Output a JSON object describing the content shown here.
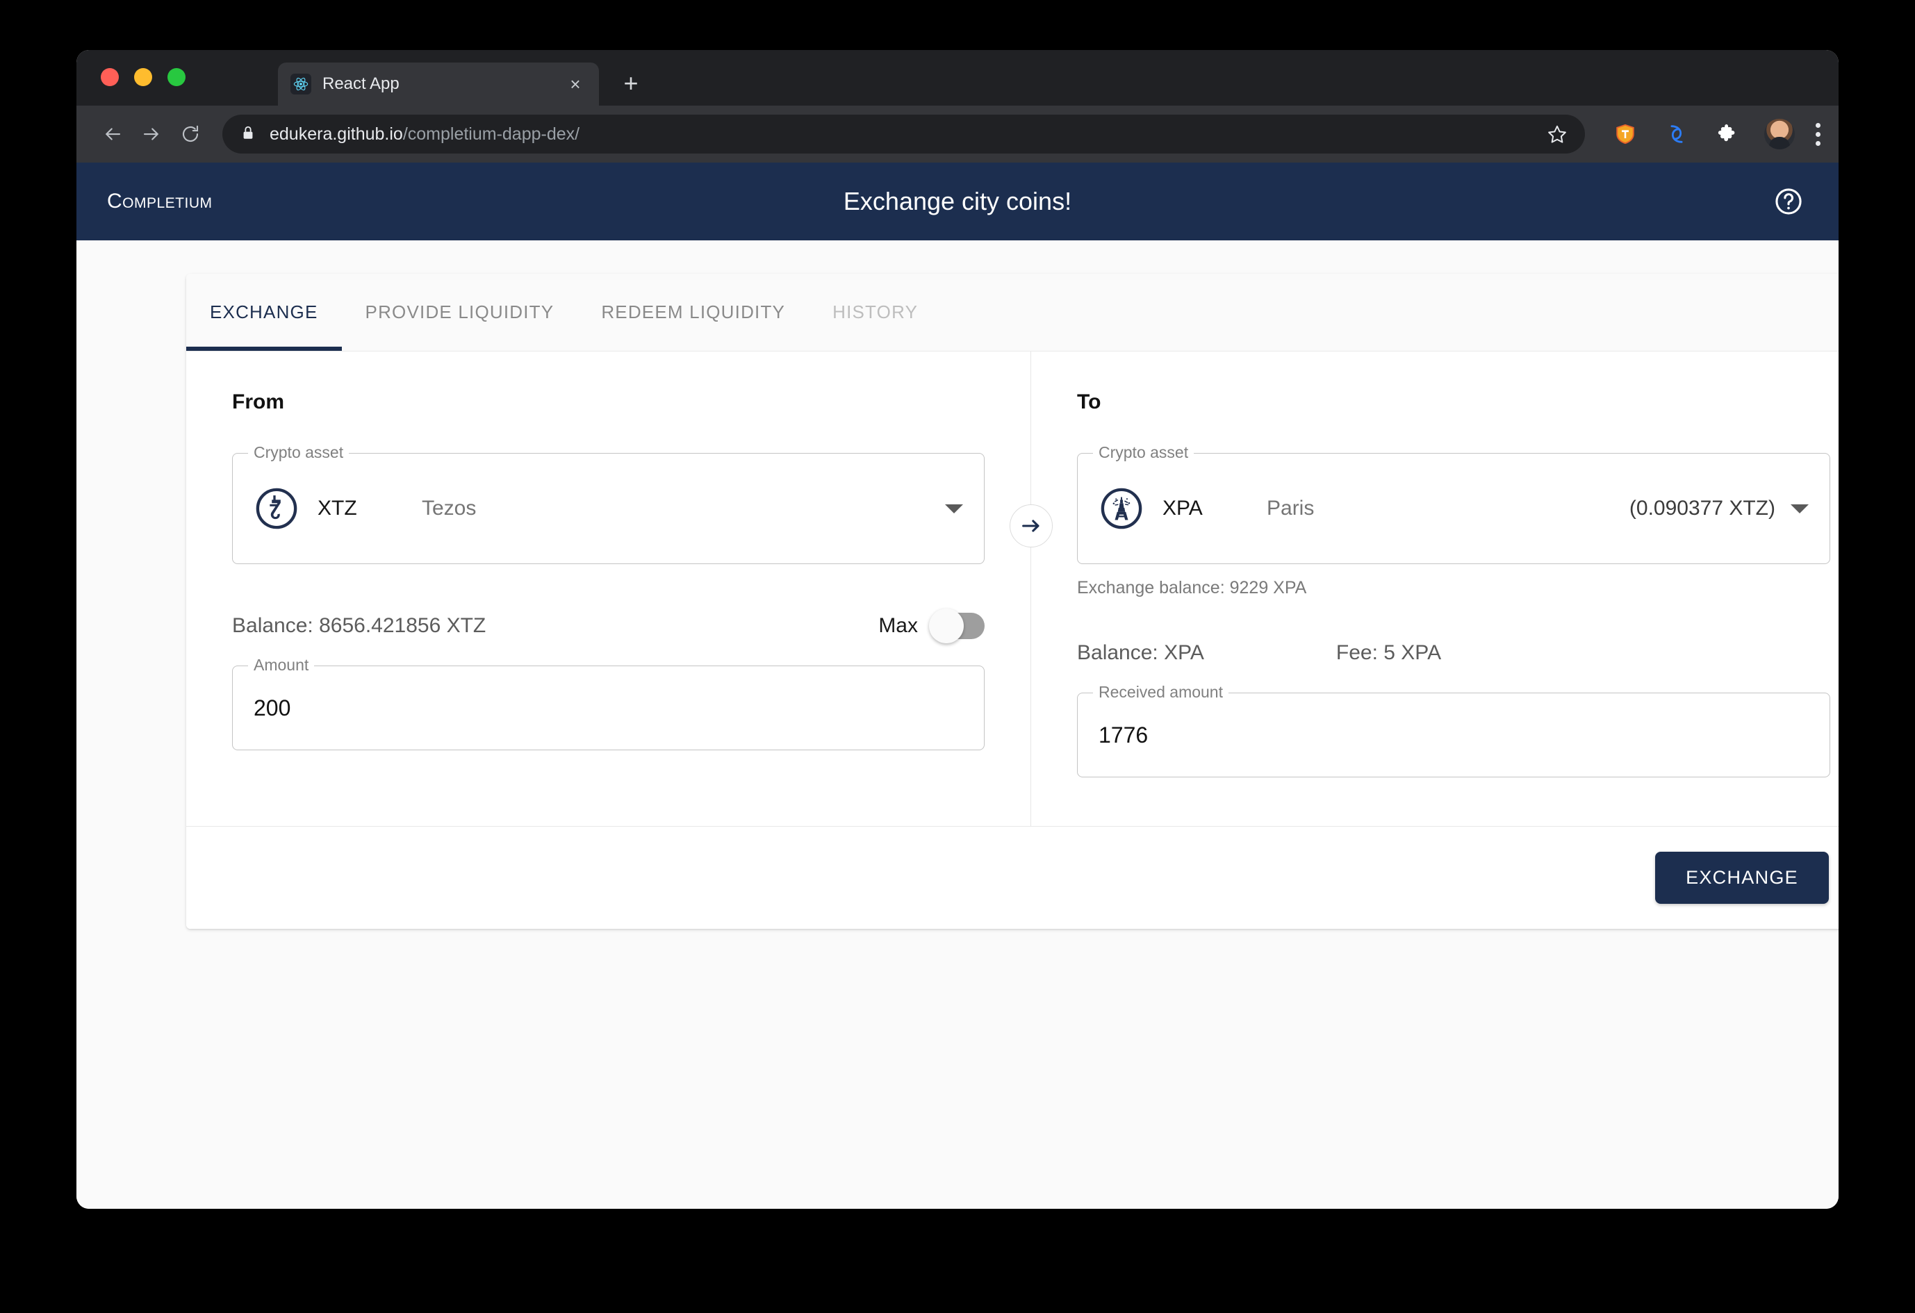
{
  "browser": {
    "tab": {
      "title": "React App",
      "favicon": "react-icon",
      "close_label": "×"
    },
    "new_tab_label": "+",
    "url_host": "edukera.github.io",
    "url_path": "/completium-dapp-dex/",
    "lock_icon": "lock-icon",
    "back_icon": "back-arrow-icon",
    "forward_icon": "forward-arrow-icon",
    "reload_icon": "reload-icon",
    "star_icon": "star-icon",
    "extensions": [
      "temple-wallet-icon",
      "beacon-icon",
      "puzzle-extensions-icon"
    ],
    "profile_icon": "avatar-icon",
    "menu_icon": "kebab-menu-icon"
  },
  "app": {
    "brand": "Completium",
    "title": "Exchange city coins!",
    "help_icon": "help-circle-icon",
    "accent_color": "#1c2e4f"
  },
  "tabs": [
    {
      "label": "EXCHANGE",
      "state": "active"
    },
    {
      "label": "PROVIDE LIQUIDITY",
      "state": "default"
    },
    {
      "label": "REDEEM LIQUIDITY",
      "state": "default"
    },
    {
      "label": "HISTORY",
      "state": "disabled"
    }
  ],
  "from": {
    "heading": "From",
    "asset_legend": "Crypto asset",
    "asset_logo": "tezos-icon",
    "symbol": "XTZ",
    "name": "Tezos",
    "balance": "Balance: 8656.421856 XTZ",
    "max_label": "Max",
    "max_on": false,
    "amount_legend": "Amount",
    "amount_value": "200"
  },
  "to": {
    "heading": "To",
    "asset_legend": "Crypto asset",
    "asset_logo": "eiffel-tower-icon",
    "symbol": "XPA",
    "name": "Paris",
    "rate": "(0.090377 XTZ)",
    "exchange_balance": "Exchange balance: 9229 XPA",
    "balance": "Balance: XPA",
    "fee": "Fee: 5 XPA",
    "received_legend": "Received amount",
    "received_value": "1776"
  },
  "swap": {
    "icon": "arrow-right-icon"
  },
  "footer": {
    "exchange_label": "EXCHANGE"
  }
}
